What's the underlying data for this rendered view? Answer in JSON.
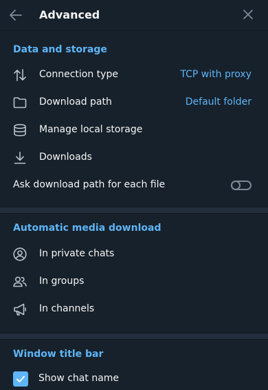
{
  "header": {
    "title": "Advanced"
  },
  "data_storage": {
    "title": "Data and storage",
    "items": [
      {
        "label": "Connection type",
        "value": "TCP with proxy",
        "icon": "arrows-updown-icon"
      },
      {
        "label": "Download path",
        "value": "Default folder",
        "icon": "folder-icon"
      },
      {
        "label": "Manage local storage",
        "icon": "database-icon"
      },
      {
        "label": "Downloads",
        "icon": "download-icon"
      }
    ],
    "ask_path": {
      "label": "Ask download path for each file",
      "enabled": false
    }
  },
  "auto_media": {
    "title": "Automatic media download",
    "items": [
      {
        "label": "In private chats",
        "icon": "user-circle-icon"
      },
      {
        "label": "In groups",
        "icon": "group-icon"
      },
      {
        "label": "In channels",
        "icon": "megaphone-icon"
      }
    ]
  },
  "window_title_bar": {
    "title": "Window title bar",
    "show_chat_name": {
      "label": "Show chat name",
      "checked": true
    }
  },
  "colors": {
    "background": "#17212b",
    "accent": "#5eb5f7",
    "text": "#f5f5f5",
    "icon": "#b8c2cc",
    "separator": "#232e3c"
  }
}
